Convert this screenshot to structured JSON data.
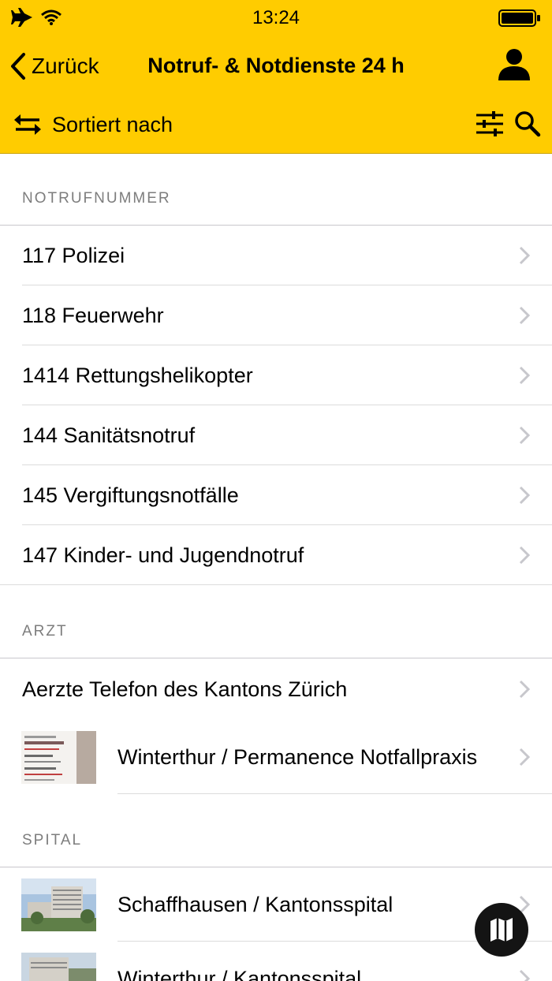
{
  "status_bar": {
    "time": "13:24"
  },
  "nav": {
    "back_label": "Zurück",
    "title": "Notruf- & Notdienste 24 h"
  },
  "toolbar": {
    "sort_label": "Sortiert nach"
  },
  "sections": {
    "notruf": {
      "title": "NOTRUFNUMMER",
      "items": [
        {
          "label": "117 Polizei"
        },
        {
          "label": "118 Feuerwehr"
        },
        {
          "label": "1414 Rettungshelikopter"
        },
        {
          "label": "144 Sanitätsnotruf"
        },
        {
          "label": "145 Vergiftungsnotfälle"
        },
        {
          "label": "147 Kinder- und Jugendnotruf"
        }
      ]
    },
    "arzt": {
      "title": "ARZT",
      "items": [
        {
          "label": "Aerzte Telefon des Kantons Zürich"
        },
        {
          "label": "Winterthur / Permanence Notfallpraxis"
        }
      ]
    },
    "spital": {
      "title": "SPITAL",
      "items": [
        {
          "label": "Schaffhausen / Kantonsspital"
        },
        {
          "label": "Winterthur / Kantonsspital"
        }
      ]
    }
  },
  "colors": {
    "header_bg": "#ffcc00",
    "section_text": "#7d7d7d",
    "fab_bg": "#141414"
  },
  "icons": {
    "airplane": "airplane-icon",
    "wifi": "wifi-icon",
    "battery": "battery-icon",
    "back": "chevron-left-icon",
    "profile": "user-icon",
    "sort": "swap-arrows-icon",
    "filter": "sliders-icon",
    "search": "search-icon",
    "disclosure": "chevron-right-icon",
    "map": "map-icon"
  }
}
